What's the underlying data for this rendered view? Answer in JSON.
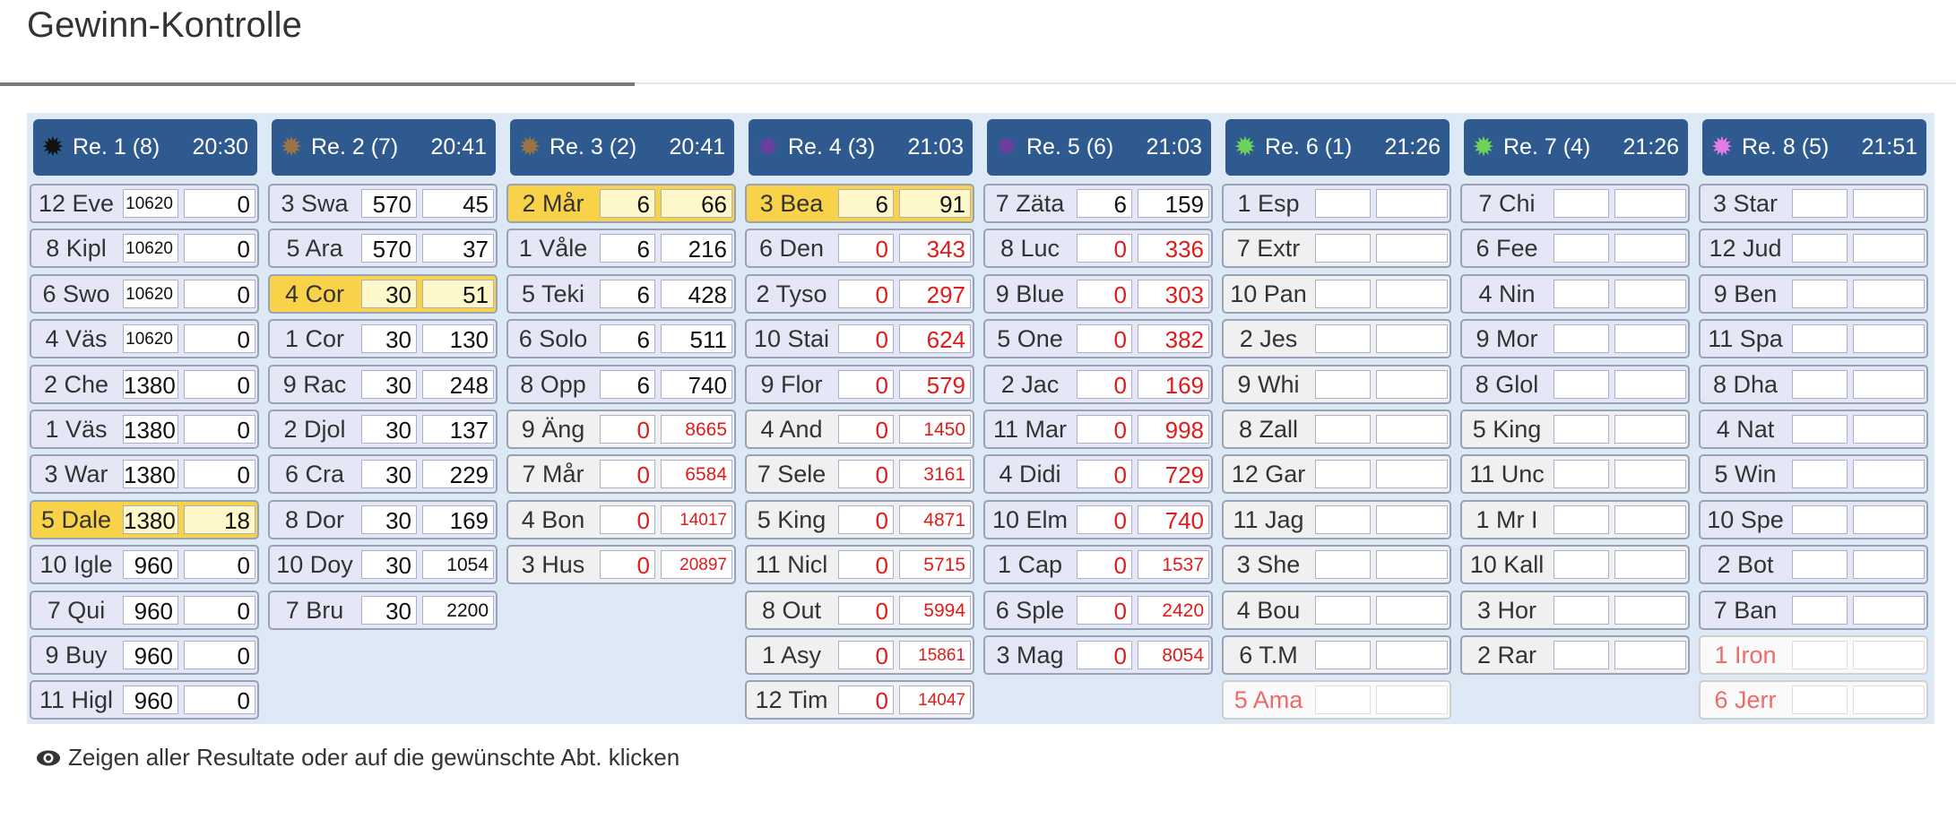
{
  "page": {
    "title": "Gewinn-Kontrolle"
  },
  "footer": {
    "icon": "eye-icon",
    "text": "Zeigen aller Resultate oder auf die gewünschte Abt. klicken"
  },
  "races": [
    {
      "label": "Re. 1 (8)",
      "time": "20:30",
      "dot_color": "#111111",
      "rows": [
        {
          "horse": "12 Eve",
          "a": "10620",
          "b": "0"
        },
        {
          "horse": "8 Kipl",
          "a": "10620",
          "b": "0"
        },
        {
          "horse": "6 Swo",
          "a": "10620",
          "b": "0"
        },
        {
          "horse": "4 Väs",
          "a": "10620",
          "b": "0"
        },
        {
          "horse": "2 Che",
          "a": "1380",
          "b": "0"
        },
        {
          "horse": "1 Väs",
          "a": "1380",
          "b": "0"
        },
        {
          "horse": "3 War",
          "a": "1380",
          "b": "0"
        },
        {
          "horse": "5 Dale",
          "a": "1380",
          "b": "18",
          "hl": true
        },
        {
          "horse": "10 Igle",
          "a": "960",
          "b": "0"
        },
        {
          "horse": "7 Qui",
          "a": "960",
          "b": "0"
        },
        {
          "horse": "9 Buy",
          "a": "960",
          "b": "0"
        },
        {
          "horse": "11 Higl",
          "a": "960",
          "b": "0"
        }
      ]
    },
    {
      "label": "Re. 2 (7)",
      "time": "20:41",
      "dot_color": "#9a7446",
      "rows": [
        {
          "horse": "3 Swa",
          "a": "570",
          "b": "45"
        },
        {
          "horse": "5 Ara",
          "a": "570",
          "b": "37"
        },
        {
          "horse": "4 Cor",
          "a": "30",
          "b": "51",
          "hl": true
        },
        {
          "horse": "1 Cor",
          "a": "30",
          "b": "130"
        },
        {
          "horse": "9 Rac",
          "a": "30",
          "b": "248"
        },
        {
          "horse": "2 Djol",
          "a": "30",
          "b": "137"
        },
        {
          "horse": "6 Cra",
          "a": "30",
          "b": "229"
        },
        {
          "horse": "8 Dor",
          "a": "30",
          "b": "169"
        },
        {
          "horse": "10 Doy",
          "a": "30",
          "b": "1054"
        },
        {
          "horse": "7 Bru",
          "a": "30",
          "b": "2200"
        }
      ]
    },
    {
      "label": "Re. 3 (2)",
      "time": "20:41",
      "dot_color": "#9a7446",
      "rows": [
        {
          "horse": "2 Mår",
          "a": "6",
          "b": "66",
          "hl": true
        },
        {
          "horse": "1 Våle",
          "a": "6",
          "b": "216"
        },
        {
          "horse": "5 Teki",
          "a": "6",
          "b": "428"
        },
        {
          "horse": "6 Solo",
          "a": "6",
          "b": "511"
        },
        {
          "horse": "8 Opp",
          "a": "6",
          "b": "740"
        },
        {
          "horse": "9 Äng",
          "a": "0",
          "b": "8665",
          "red": true,
          "gray": true
        },
        {
          "horse": "7 Mår",
          "a": "0",
          "b": "6584",
          "red": true,
          "gray": true
        },
        {
          "horse": "4 Bon",
          "a": "0",
          "b": "14017",
          "red": true,
          "gray": true
        },
        {
          "horse": "3 Hus",
          "a": "0",
          "b": "20897",
          "red": true,
          "gray": true
        }
      ]
    },
    {
      "label": "Re. 4 (3)",
      "time": "21:03",
      "dot_color": "#6b3fa0",
      "rows": [
        {
          "horse": "3 Bea",
          "a": "6",
          "b": "91",
          "hl": true
        },
        {
          "horse": "6 Den",
          "a": "0",
          "b": "343",
          "red": true
        },
        {
          "horse": "2 Tyso",
          "a": "0",
          "b": "297",
          "red": true
        },
        {
          "horse": "10 Stai",
          "a": "0",
          "b": "624",
          "red": true
        },
        {
          "horse": "9 Flor",
          "a": "0",
          "b": "579",
          "red": true
        },
        {
          "horse": "4 And",
          "a": "0",
          "b": "1450",
          "red": true,
          "gray": true
        },
        {
          "horse": "7 Sele",
          "a": "0",
          "b": "3161",
          "red": true,
          "gray": true
        },
        {
          "horse": "5 King",
          "a": "0",
          "b": "4871",
          "red": true,
          "gray": true
        },
        {
          "horse": "11 Nicl",
          "a": "0",
          "b": "5715",
          "red": true,
          "gray": true
        },
        {
          "horse": "8 Out",
          "a": "0",
          "b": "5994",
          "red": true,
          "gray": true
        },
        {
          "horse": "1 Asy",
          "a": "0",
          "b": "15861",
          "red": true,
          "gray": true
        },
        {
          "horse": "12 Tim",
          "a": "0",
          "b": "14047",
          "red": true,
          "gray": true
        }
      ]
    },
    {
      "label": "Re. 5 (6)",
      "time": "21:03",
      "dot_color": "#6b3fa0",
      "rows": [
        {
          "horse": "7 Zäta",
          "a": "6",
          "b": "159"
        },
        {
          "horse": "8 Luc",
          "a": "0",
          "b": "336",
          "red": true
        },
        {
          "horse": "9 Blue",
          "a": "0",
          "b": "303",
          "red": true
        },
        {
          "horse": "5 One",
          "a": "0",
          "b": "382",
          "red": true
        },
        {
          "horse": "2 Jac",
          "a": "0",
          "b": "169",
          "red": true
        },
        {
          "horse": "11 Mar",
          "a": "0",
          "b": "998",
          "red": true
        },
        {
          "horse": "4 Didi",
          "a": "0",
          "b": "729",
          "red": true
        },
        {
          "horse": "10 Elm",
          "a": "0",
          "b": "740",
          "red": true
        },
        {
          "horse": "1 Cap",
          "a": "0",
          "b": "1537",
          "red": true
        },
        {
          "horse": "6 Sple",
          "a": "0",
          "b": "2420",
          "red": true
        },
        {
          "horse": "3 Mag",
          "a": "0",
          "b": "8054",
          "red": true
        }
      ]
    },
    {
      "label": "Re. 6 (1)",
      "time": "21:26",
      "dot_color": "#6dd35a",
      "rows": [
        {
          "horse": "1 Esp",
          "a": "",
          "b": ""
        },
        {
          "horse": "7 Extr",
          "a": "",
          "b": "",
          "gray": true
        },
        {
          "horse": "10 Pan",
          "a": "",
          "b": "",
          "gray": true
        },
        {
          "horse": "2 Jes",
          "a": "",
          "b": "",
          "gray": true
        },
        {
          "horse": "9 Whi",
          "a": "",
          "b": "",
          "gray": true
        },
        {
          "horse": "8 Zall",
          "a": "",
          "b": "",
          "gray": true
        },
        {
          "horse": "12 Gar",
          "a": "",
          "b": "",
          "gray": true
        },
        {
          "horse": "11 Jag",
          "a": "",
          "b": "",
          "gray": true
        },
        {
          "horse": "3 She",
          "a": "",
          "b": "",
          "gray": true
        },
        {
          "horse": "4 Bou",
          "a": "",
          "b": "",
          "gray": true
        },
        {
          "horse": "6 T.M",
          "a": "",
          "b": "",
          "gray": true
        },
        {
          "horse": "5 Ama",
          "a": "",
          "b": "",
          "faded": true
        }
      ]
    },
    {
      "label": "Re. 7 (4)",
      "time": "21:26",
      "dot_color": "#6dd35a",
      "rows": [
        {
          "horse": "7 Chi",
          "a": "",
          "b": ""
        },
        {
          "horse": "6 Fee",
          "a": "",
          "b": ""
        },
        {
          "horse": "4 Nin",
          "a": "",
          "b": ""
        },
        {
          "horse": "9 Mor",
          "a": "",
          "b": ""
        },
        {
          "horse": "8 Glol",
          "a": "",
          "b": ""
        },
        {
          "horse": "5 King",
          "a": "",
          "b": "",
          "gray": true
        },
        {
          "horse": "11 Unc",
          "a": "",
          "b": "",
          "gray": true
        },
        {
          "horse": "1 Mr I",
          "a": "",
          "b": "",
          "gray": true
        },
        {
          "horse": "10 Kall",
          "a": "",
          "b": "",
          "gray": true
        },
        {
          "horse": "3 Hor",
          "a": "",
          "b": "",
          "gray": true
        },
        {
          "horse": "2 Rar",
          "a": "",
          "b": "",
          "gray": true
        }
      ]
    },
    {
      "label": "Re. 8 (5)",
      "time": "21:51",
      "dot_color": "#e57be8",
      "rows": [
        {
          "horse": "3 Star",
          "a": "",
          "b": ""
        },
        {
          "horse": "12 Jud",
          "a": "",
          "b": ""
        },
        {
          "horse": "9 Ben",
          "a": "",
          "b": ""
        },
        {
          "horse": "11 Spa",
          "a": "",
          "b": ""
        },
        {
          "horse": "8 Dha",
          "a": "",
          "b": ""
        },
        {
          "horse": "4 Nat",
          "a": "",
          "b": ""
        },
        {
          "horse": "5 Win",
          "a": "",
          "b": ""
        },
        {
          "horse": "10 Spe",
          "a": "",
          "b": ""
        },
        {
          "horse": "2 Bot",
          "a": "",
          "b": ""
        },
        {
          "horse": "7 Ban",
          "a": "",
          "b": ""
        },
        {
          "horse": "1 Iron",
          "a": "",
          "b": "",
          "faded": true
        },
        {
          "horse": "6 Jerr",
          "a": "",
          "b": "",
          "faded": true
        }
      ]
    }
  ]
}
